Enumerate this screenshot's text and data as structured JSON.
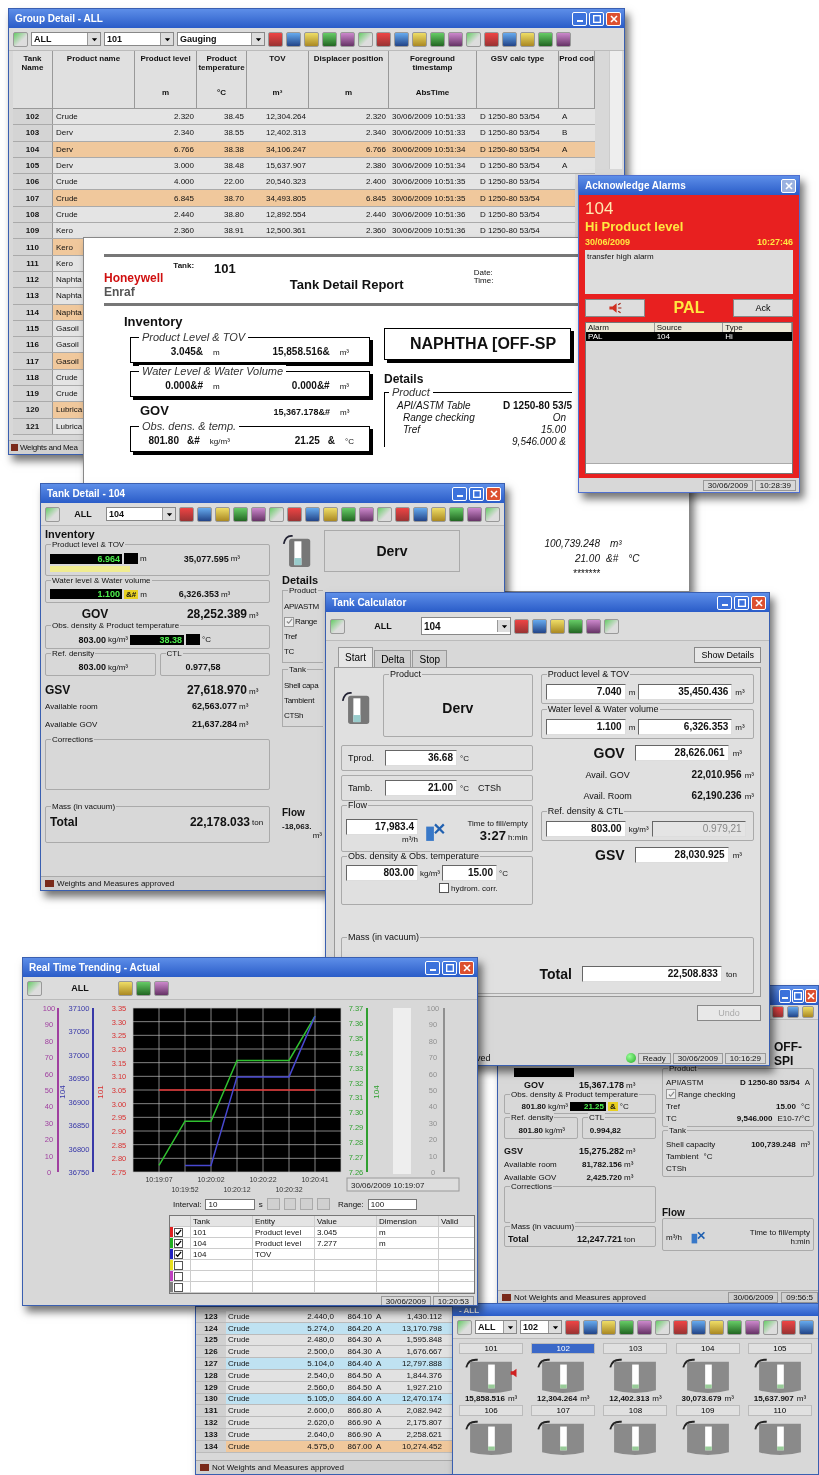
{
  "group_detail": {
    "title": "Group Detail - ALL",
    "combos": [
      "ALL",
      "101",
      "Gauging"
    ],
    "columns": [
      {
        "label": "Tank Name"
      },
      {
        "label": "Product name"
      },
      {
        "label": "Product level",
        "unit": "m"
      },
      {
        "label": "Product temperature",
        "unit": "°C"
      },
      {
        "label": "TOV",
        "unit": "m³"
      },
      {
        "label": "Displacer position",
        "unit": "m"
      },
      {
        "label": "Foreground timestamp",
        "unit": "AbsTime"
      },
      {
        "label": "GSV calc type"
      },
      {
        "label": "Prod cod"
      }
    ],
    "rows": [
      {
        "cells": [
          "102",
          "Crude",
          "2.320",
          "38.45",
          "12,304.264",
          "2.320",
          "30/06/2009 10:51:33",
          "D 1250-80 53/54",
          "A"
        ]
      },
      {
        "cells": [
          "103",
          "Derv",
          "2.340",
          "38.55",
          "12,402.313",
          "2.340",
          "30/06/2009 10:51:33",
          "D 1250-80 53/54",
          "B"
        ]
      },
      {
        "color": "#f0c89c",
        "cells": [
          "104",
          "Derv",
          "6.766",
          "38.38",
          "34,106.247",
          "6.766",
          "30/06/2009 10:51:34",
          "D 1250-80 53/54",
          "A"
        ]
      },
      {
        "cells": [
          "105",
          "Derv",
          "3.000",
          "38.48",
          "15,637.907",
          "2.380",
          "30/06/2009 10:51:34",
          "D 1250-80 53/54",
          "A"
        ]
      },
      {
        "cells": [
          "106",
          "Crude",
          "4.000",
          "22.00",
          "20,540.323",
          "2.400",
          "30/06/2009 10:51:35",
          "D 1250-80 53/54"
        ]
      },
      {
        "color": "#f0c89c",
        "cells": [
          "107",
          "Crude",
          "6.845",
          "38.70",
          "34,493.805",
          "6.845",
          "30/06/2009 10:51:35",
          "D 1250-80 53/54"
        ]
      },
      {
        "cells": [
          "108",
          "Crude",
          "2.440",
          "38.80",
          "12,892.554",
          "2.440",
          "30/06/2009 10:51:36",
          "D 1250-80 53/54"
        ]
      },
      {
        "cells": [
          "109",
          "Kero",
          "2.360",
          "38.91",
          "12,500.361",
          "2.360",
          "30/06/2009 10:51:36",
          "D 1250-80 53/54"
        ]
      },
      {
        "color": "#f0c89c",
        "cells": [
          "110",
          "Kero"
        ]
      },
      {
        "cells": [
          "111",
          "Kero"
        ]
      },
      {
        "cells": [
          "112",
          "Naphta"
        ]
      },
      {
        "cells": [
          "113",
          "Naphta"
        ]
      },
      {
        "color": "#f0c89c",
        "cells": [
          "114",
          "Naphta"
        ]
      },
      {
        "cells": [
          "115",
          "Gasoil"
        ]
      },
      {
        "cells": [
          "116",
          "Gasoil"
        ]
      },
      {
        "color": "#f0c89c",
        "cells": [
          "117",
          "Gasoil"
        ]
      },
      {
        "cells": [
          "118",
          "Crude"
        ]
      },
      {
        "cells": [
          "119",
          "Crude"
        ]
      },
      {
        "color": "#f0c89c",
        "cells": [
          "120",
          "Lubrica"
        ]
      },
      {
        "cells": [
          "121",
          "Lubrica"
        ]
      }
    ],
    "status": "Weights and Mea"
  },
  "report": {
    "tank_label": "Tank:",
    "tank": "101",
    "brand": "Honeywell",
    "brand_sub": "Enraf",
    "title": "Tank Detail Report",
    "date_label": "Date:",
    "time_label": "Time:",
    "heading": "Inventory",
    "groups": [
      {
        "label": "Product Level & TOV",
        "level": "3.045&",
        "level_unit": "m",
        "volume": "15,858.516&",
        "volume_unit": "m³"
      },
      {
        "label": "Water Level & Water Volume",
        "level": "0.000&#",
        "level_unit": "m",
        "volume": "0.000&#",
        "volume_unit": "m³"
      }
    ],
    "gov": {
      "label": "GOV",
      "value": "15,367.178&#",
      "unit": "m³"
    },
    "obs": {
      "label": "Obs. dens. & temp.",
      "density": "801.80",
      "density_flag": "&#",
      "density_unit": "kg/m³",
      "temp": "21.25",
      "temp_flag": "&",
      "temp_unit": "°C"
    },
    "product_name": "NAPHTHA [OFF-SP",
    "details": "Details",
    "product_group": "Product",
    "detail_rows": [
      {
        "label": "API/ASTM Table",
        "value": "D 1250-80 53/5"
      },
      {
        "label": "Range checking",
        "value": "On"
      },
      {
        "label": "Tref",
        "value": "15.00"
      },
      {
        "value": "9,546.000 &"
      }
    ],
    "lower_rows": [
      {
        "value": "100,739.248",
        "unit": "m³"
      },
      {
        "value": "21.00",
        "flag": "&#",
        "unit": "°C"
      },
      {
        "value": "*******"
      }
    ]
  },
  "alarm_window": {
    "title": "Acknowledge Alarms",
    "tank": "104",
    "alarm": "Hi Product level",
    "date": "30/06/2009",
    "time": "10:27:46",
    "message": "transfer high alarm",
    "code": "PAL",
    "ack": "Ack",
    "columns": [
      "Alarm",
      "Source",
      "Type"
    ],
    "rows": [
      {
        "cells": [
          "PAL",
          "104",
          "Hi"
        ],
        "selected": true
      }
    ],
    "status": [
      "30/06/2009",
      "10:28:39"
    ]
  },
  "tank_detail": {
    "title": "Tank Detail - 104",
    "filter": "ALL",
    "tank": "104",
    "heading": "Inventory",
    "level_group": {
      "label": "Product level & TOV",
      "level": "6.964",
      "unit": "m",
      "volume": "35,077.595",
      "volume_unit": "m³"
    },
    "water_group": {
      "label": "Water level & Water volume",
      "level": "1.100",
      "flag": "&#",
      "unit": "m",
      "volume": "6,326.353",
      "volume_unit": "m³"
    },
    "gov": {
      "label": "GOV",
      "value": "28,252.389",
      "unit": "m³"
    },
    "obs_group": {
      "label": "Obs. density & Product temperature",
      "density": "803.00",
      "density_unit": "kg/m³",
      "temp": "38.38",
      "temp_unit": "°C"
    },
    "ref_group": {
      "label": "Ref. density",
      "value": "803.00",
      "unit": "kg/m³"
    },
    "ctl_group": {
      "label": "CTL",
      "value": "0.977,58"
    },
    "gsv": {
      "label": "GSV",
      "value": "27,618.970",
      "unit": "m³"
    },
    "avail": [
      {
        "label": "Available room",
        "value": "62,563.077",
        "unit": "m³"
      },
      {
        "label": "Available GOV",
        "value": "21,637.284",
        "unit": "m³"
      }
    ],
    "corrections": "Corrections",
    "mass": {
      "label": "Mass (in vacuum)",
      "total_label": "Total",
      "value": "22,178.033",
      "unit": "ton"
    },
    "product": "Derv",
    "details": "Details",
    "product_box": {
      "label": "Product",
      "rows": [
        {
          "kind": "text",
          "label": "API/ASTM"
        },
        {
          "kind": "checkbox",
          "label": "Range",
          "checked": true
        },
        {
          "kind": "text",
          "label": "Tref"
        },
        {
          "kind": "text",
          "label": "TC"
        }
      ]
    },
    "tank_box": {
      "label": "Tank",
      "rows": [
        {
          "kind": "text",
          "label": "Shell capa"
        },
        {
          "kind": "text",
          "label": "Tambient"
        },
        {
          "kind": "text",
          "label": "CTSh"
        }
      ]
    },
    "flow": {
      "label": "Flow",
      "value": "-18,063.",
      "unit": "m³"
    },
    "status": "Weights and Measures approved"
  },
  "tank_detail_2": {
    "product_name": "OFF-SPI",
    "gov": {
      "label": "GOV",
      "value": "15,367.178",
      "unit": "m³"
    },
    "obs_group": {
      "label": "Obs. density & Product temperature",
      "density": "801.80",
      "density_unit": "kg/m³",
      "temp": "21.25",
      "flag": "&",
      "temp_unit": "°C"
    },
    "ref_group": {
      "label": "Ref. density",
      "value": "801.80",
      "unit": "kg/m³"
    },
    "ctl_group": {
      "label": "CTL",
      "value": "0.994,82"
    },
    "gsv": {
      "label": "GSV",
      "value": "15,275.282",
      "unit": "m³"
    },
    "avail": [
      {
        "label": "Available room",
        "value": "81,782.156",
        "unit": "m³"
      },
      {
        "label": "Available GOV",
        "value": "2,425.720",
        "unit": "m³"
      }
    ],
    "corrections": "Corrections",
    "mass": {
      "label": "Mass (in vacuum)",
      "total_label": "Total",
      "value": "12,247.721",
      "unit": "ton"
    },
    "product_box": {
      "label": "Product",
      "rows": [
        {
          "kind": "text",
          "label": "API/ASTM",
          "value": "D 1250-80 53/54",
          "extra": "A"
        },
        {
          "kind": "checkbox",
          "label": "Range checking",
          "checked": true
        },
        {
          "kind": "text",
          "label": "Tref",
          "value": "15.00",
          "extra": "°C"
        },
        {
          "kind": "text",
          "label": "TC",
          "value": "9,546.000",
          "extra": "E10-7/°C"
        }
      ]
    },
    "tank_box": {
      "label": "Tank",
      "rows": [
        {
          "kind": "text",
          "label": "Shell capacity",
          "value": "100,739.248",
          "extra": "m³"
        },
        {
          "kind": "text",
          "label": "Tambient",
          "extra": "°C"
        },
        {
          "kind": "text",
          "label": "CTSh"
        }
      ]
    },
    "flow": {
      "label": "Flow",
      "unit": "m³/h",
      "fill_label": "Time to fill/empty",
      "fill_unit": "h:min"
    },
    "status": {
      "text": "Not Weights and Measures approved",
      "date": "30/06/2009",
      "time": "09:56:5"
    }
  },
  "calculator": {
    "title": "Tank Calculator",
    "filter": "ALL",
    "tank": "104",
    "tabs": [
      {
        "label": "Start",
        "selected": true
      },
      {
        "label": "Delta",
        "selected": false
      },
      {
        "label": "Stop",
        "selected": false
      }
    ],
    "show_details": "Show Details",
    "product": {
      "label": "Product",
      "value": "Derv"
    },
    "tprod": {
      "label": "Tprod.",
      "value": "36.68",
      "unit": "°C"
    },
    "tamb": {
      "label": "Tamb.",
      "value": "21.00",
      "unit": "°C",
      "extra": "CTSh"
    },
    "flow": {
      "label": "Flow",
      "value": "17,983.4",
      "unit": "m³/h",
      "fill_label": "Time to fill/empty",
      "fill_value": "3:27",
      "fill_unit": "h:min"
    },
    "obs": {
      "label": "Obs. density & Obs. temperature",
      "density": "803.00",
      "density_unit": "kg/m³",
      "temp": "15.00",
      "temp_unit": "°C",
      "hydrom_label": "hydrom. corr.",
      "hydrom_checked": false
    },
    "level": {
      "label": "Product level & TOV",
      "level": "7.040",
      "unit": "m",
      "volume": "35,450.436",
      "volume_unit": "m³"
    },
    "water": {
      "label": "Water level & Water volume",
      "level": "1.100",
      "unit": "m",
      "volume": "6,326.353",
      "volume_unit": "m³"
    },
    "gov": {
      "label": "GOV",
      "value": "28,626.061",
      "unit": "m³"
    },
    "avail": [
      {
        "label": "Avail. GOV",
        "value": "22,010.956",
        "unit": "m³"
      },
      {
        "label": "Avail. Room",
        "value": "62,190.236",
        "unit": "m³"
      }
    ],
    "ref": {
      "label": "Ref. density & CTL",
      "density": "803.00",
      "unit": "kg/m³",
      "ctl": "0.979,21"
    },
    "gsv": {
      "label": "GSV",
      "value": "28,030.925",
      "unit": "m³"
    },
    "mass": {
      "label": "Mass (in vacuum)",
      "total_label": "Total",
      "value": "22,508.833",
      "unit": "ton"
    },
    "undo": {
      "label": "Undo",
      "disabled": true
    },
    "status": {
      "left": "ved",
      "state": "Ready",
      "date": "30/06/2009",
      "time": "10:16:29"
    }
  },
  "trending": {
    "title": "Real Time Trending - Actual",
    "filter": "ALL",
    "chart_data": {
      "type": "line",
      "categories": [
        "10:19:07",
        "10:19:52",
        "10:20:02",
        "10:20:12",
        "10:20:22",
        "10:20:32",
        "10:20:41"
      ],
      "ylabel": "101",
      "ylim": [
        2.75,
        3.35
      ],
      "grid": true,
      "yticks": [
        2.75,
        {
          "value": 2.8,
          "label": "2.80"
        },
        2.85,
        {
          "value": 2.9,
          "label": "2.90"
        },
        2.95,
        {
          "value": 3,
          "label": "3.00"
        },
        3.05,
        {
          "value": 3.1,
          "label": "3.10"
        },
        3.15,
        {
          "value": 3.2,
          "label": "3.20"
        },
        3.25,
        {
          "value": 3.3,
          "label": "3.30"
        },
        3.35
      ],
      "series": [
        {
          "color": "#e03030",
          "values": [
            3.05,
            3.05,
            3.05,
            3.05,
            3.05,
            3.05,
            3.05
          ]
        },
        {
          "color": "#30c030",
          "values": [
            2.774,
            2.936,
            2.936,
            3.158,
            3.158,
            3.158,
            3.32
          ]
        },
        {
          "color": "#4848d0",
          "values": [
            null,
            2.774,
            2.774,
            3.098,
            3.098,
            3.098,
            3.32
          ]
        }
      ]
    },
    "axes": [
      {
        "color": "#a040a0",
        "ticks": [
          "100",
          "90",
          "80",
          "70",
          "60",
          "50",
          "40",
          "30",
          "20",
          "10",
          "0"
        ]
      },
      {
        "label": "104",
        "color": "#3838a8",
        "ticks": [
          "37100",
          "37050",
          "37000",
          "36950",
          "36900",
          "36850",
          "36800",
          "36750"
        ]
      },
      {
        "label": "104",
        "color": "#30a030",
        "ticks": [
          "7.37",
          "7.36",
          "7.35",
          "7.34",
          "7.33",
          "7.32",
          "7.31",
          "7.30",
          "7.29",
          "7.28",
          "7.27",
          "7.26"
        ]
      },
      {
        "color": "#909090",
        "ticks": [
          "100",
          "90",
          "80",
          "70",
          "60",
          "50",
          "40",
          "30",
          "20",
          "10",
          "0"
        ]
      }
    ],
    "timestamp": "30/06/2009 10:19:07",
    "interval_label": "Interval:",
    "interval": "10",
    "interval_unit": "s",
    "range_label": "Range:",
    "range": "100",
    "columns": [
      "Tank",
      "Entity",
      "Value",
      "Dimension",
      "Valid"
    ],
    "rows": [
      {
        "color": "#e02020",
        "checked": true,
        "cells": [
          "101",
          "Product level",
          "3.045",
          "m"
        ]
      },
      {
        "color": "#20b020",
        "checked": true,
        "cells": [
          "104",
          "Product level",
          "7.277",
          "m"
        ]
      },
      {
        "color": "#2020c0",
        "checked": true,
        "cells": [
          "104",
          "TOV"
        ]
      },
      {
        "color": "#e8e020",
        "checked": false
      },
      {
        "color": "#c040c0",
        "checked": false
      },
      {
        "color": "#808080",
        "checked": false
      }
    ],
    "status": [
      "30/06/2009",
      "10:20:53"
    ]
  },
  "group_list": {
    "rows": [
      {
        "cells": [
          "123",
          "Crude",
          "2.440,0",
          "864.10",
          "A",
          "1,430.112"
        ]
      },
      {
        "color": "#bfe2f2",
        "cells": [
          "124",
          "Crude",
          "5.274,0",
          "864.20",
          "A",
          "13,170.798"
        ]
      },
      {
        "cells": [
          "125",
          "Crude",
          "2.480,0",
          "864.30",
          "A",
          "1,595.848"
        ]
      },
      {
        "cells": [
          "126",
          "Crude",
          "2.500,0",
          "864.30",
          "A",
          "1,676.667"
        ]
      },
      {
        "color": "#bfe2f2",
        "cells": [
          "127",
          "Crude",
          "5.104,0",
          "864.40",
          "A",
          "12,797.888"
        ]
      },
      {
        "cells": [
          "128",
          "Crude",
          "2.540,0",
          "864.50",
          "A",
          "1,844.376"
        ]
      },
      {
        "cells": [
          "129",
          "Crude",
          "2.560,0",
          "864.50",
          "A",
          "1,927.210"
        ]
      },
      {
        "color": "#bfe2f2",
        "cells": [
          "130",
          "Crude",
          "5.105,0",
          "864.60",
          "A",
          "12,470.174"
        ]
      },
      {
        "cells": [
          "131",
          "Crude",
          "2.600,0",
          "866.80",
          "A",
          "2,082.942"
        ]
      },
      {
        "cells": [
          "132",
          "Crude",
          "2.620,0",
          "866.90",
          "A",
          "2,175.807"
        ]
      },
      {
        "cells": [
          "133",
          "Crude",
          "2.640,0",
          "866.90",
          "A",
          "2,258.621"
        ]
      },
      {
        "color": "#f0c89c",
        "cells": [
          "134",
          "Crude",
          "4.575,0",
          "867.00",
          "A",
          "10,274.452"
        ]
      }
    ],
    "status": "Not Weights and Measures approved"
  },
  "overview": {
    "title": "- ALL",
    "filter": "ALL",
    "tank": "102",
    "tanks": [
      {
        "name": "101",
        "selected": false,
        "alarm": true,
        "value": "15,858.516",
        "unit": "m³"
      },
      {
        "name": "102",
        "selected": true,
        "alarm": false,
        "value": "12,304.264",
        "unit": "m³"
      },
      {
        "name": "103",
        "selected": false,
        "alarm": false,
        "value": "12,402.313",
        "unit": "m³"
      },
      {
        "name": "104",
        "selected": false,
        "alarm": false,
        "value": "30,073.679",
        "unit": "m³"
      },
      {
        "name": "105",
        "selected": false,
        "alarm": false,
        "value": "15,637.907",
        "unit": "m³"
      },
      {
        "name": "106",
        "selected": false,
        "alarm": false
      },
      {
        "name": "107",
        "selected": false,
        "alarm": false
      },
      {
        "name": "108",
        "selected": false,
        "alarm": false
      },
      {
        "name": "109",
        "selected": false,
        "alarm": false
      },
      {
        "name": "110",
        "selected": false,
        "alarm": false
      }
    ]
  }
}
